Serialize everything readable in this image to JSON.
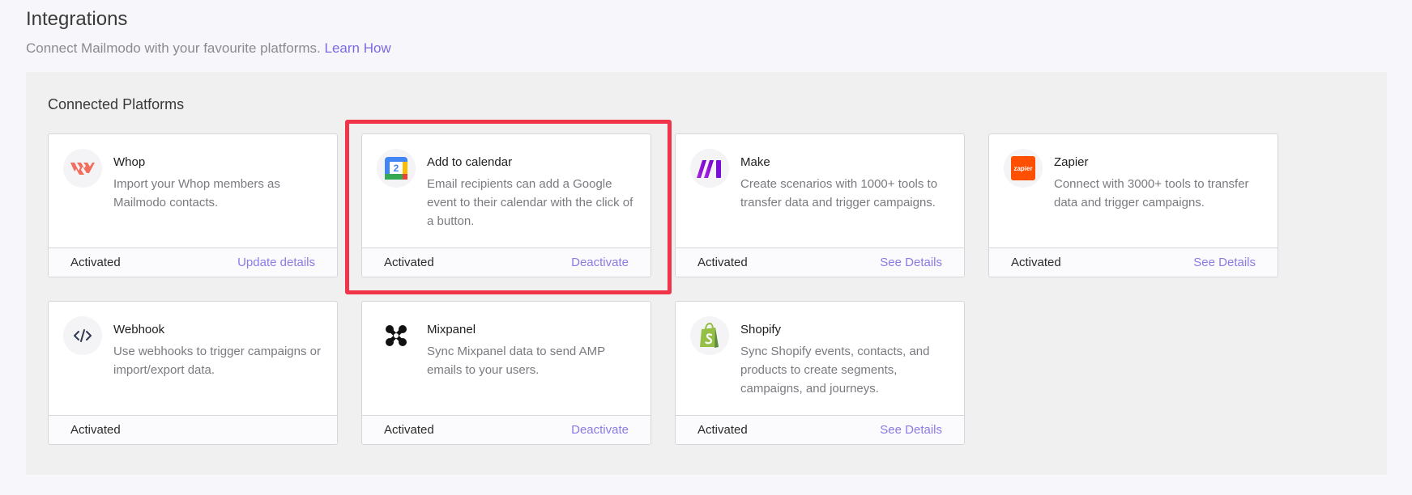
{
  "header": {
    "title": "Integrations",
    "subtitle": "Connect Mailmodo with your favourite platforms.",
    "learn_link": "Learn How"
  },
  "section": {
    "title": "Connected Platforms"
  },
  "colors": {
    "accent_link": "#8a7be6",
    "highlight_border": "#f0344a",
    "panel_bg": "#f0f0f0"
  },
  "cards": [
    {
      "name": "Whop",
      "icon": "whop-logo-icon",
      "description": "Import your Whop members as Mailmodo contacts.",
      "status": "Activated",
      "action": "Update details"
    },
    {
      "name": "Add to calendar",
      "icon": "google-calendar-icon",
      "icon_text": "2",
      "description": "Email recipients can add a Google event to their calendar with the click of a button.",
      "status": "Activated",
      "action": "Deactivate",
      "highlighted": true
    },
    {
      "name": "Make",
      "icon": "make-logo-icon",
      "description": "Create scenarios with 1000+ tools to transfer data and trigger campaigns.",
      "status": "Activated",
      "action": "See Details"
    },
    {
      "name": "Zapier",
      "icon": "zapier-logo-icon",
      "icon_text": "zapier",
      "description": "Connect with 3000+ tools to transfer data and trigger campaigns.",
      "status": "Activated",
      "action": "See Details"
    },
    {
      "name": "Webhook",
      "icon": "webhook-code-icon",
      "description": "Use webhooks to trigger campaigns or import/export data.",
      "status": "Activated",
      "action": ""
    },
    {
      "name": "Mixpanel",
      "icon": "mixpanel-logo-icon",
      "description": "Sync Mixpanel data to send AMP emails to your users.",
      "status": "Activated",
      "action": "Deactivate"
    },
    {
      "name": "Shopify",
      "icon": "shopify-logo-icon",
      "description": "Sync Shopify events, contacts, and products to create segments, campaigns, and journeys.",
      "status": "Activated",
      "action": "See Details"
    }
  ]
}
